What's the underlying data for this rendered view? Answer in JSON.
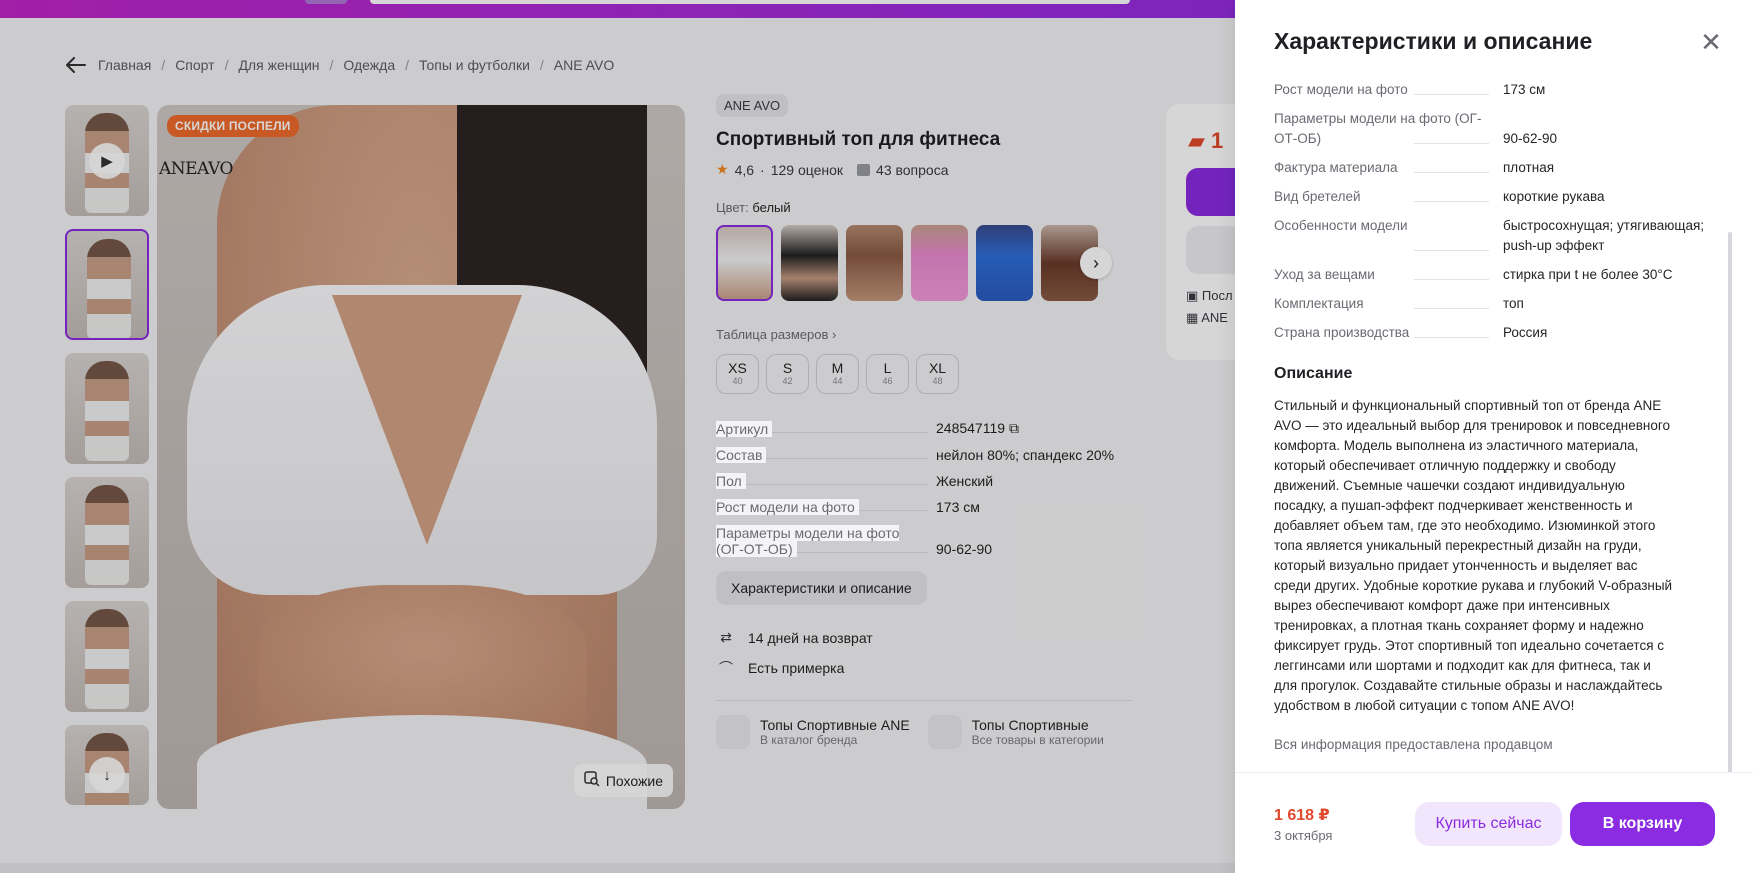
{
  "breadcrumb": [
    "Главная",
    "Спорт",
    "Для женщин",
    "Одежда",
    "Топы и футболки",
    "ANE AVO"
  ],
  "gallery": {
    "sale_badge": "СКИДКИ ПОСПЕЛИ",
    "brand_mark": "ANEAVO",
    "similar_label": "Похожие"
  },
  "product": {
    "brand": "ANE AVO",
    "title": "Спортивный топ для фитнеса",
    "rating": "4,6",
    "reviews": "129 оценок",
    "questions": "43 вопроса",
    "color_label": "Цвет:",
    "color_value": "белый",
    "size_table_label": "Таблица размеров",
    "sizes": [
      {
        "name": "XS",
        "ru": "40"
      },
      {
        "name": "S",
        "ru": "42"
      },
      {
        "name": "M",
        "ru": "44"
      },
      {
        "name": "L",
        "ru": "46"
      },
      {
        "name": "XL",
        "ru": "48"
      }
    ],
    "specs": [
      {
        "k": "Артикул",
        "v": "248547119"
      },
      {
        "k": "Состав",
        "v": "нейлон 80%; спандекс 20%"
      },
      {
        "k": "Пол",
        "v": "Женский"
      },
      {
        "k": "Рост модели на фото",
        "v": "173 см"
      },
      {
        "k": "Параметры модели на фото (ОГ-ОТ-ОБ)",
        "v": "90-62-90"
      }
    ],
    "chars_button": "Характеристики и описание",
    "perks": [
      "14 дней на возврат",
      "Есть примерка"
    ],
    "categories": [
      {
        "title": "Топы Спортивные ANE",
        "sub": "В каталог бренда"
      },
      {
        "title": "Топы Спортивные",
        "sub": "Все товары в категории"
      }
    ]
  },
  "buybox": {
    "price_fragment": "1",
    "row1": "Посл",
    "row2": "ANE"
  },
  "drawer": {
    "title": "Характеристики и описание",
    "specs": [
      {
        "k": "Рост модели на фото",
        "v": "173 см"
      },
      {
        "k": "Параметры модели на фото (ОГ-ОТ-ОБ)",
        "v": "90-62-90"
      },
      {
        "k": "Фактура материала",
        "v": "плотная"
      },
      {
        "k": "Вид бретелей",
        "v": "короткие рукава"
      },
      {
        "k": "Особенности модели",
        "v": "быстросохнущая; утягивающая; push-up эффект"
      },
      {
        "k": "Уход за вещами",
        "v": "стирка при t не более 30°C"
      },
      {
        "k": "Комплектация",
        "v": "топ"
      },
      {
        "k": "Страна производства",
        "v": "Россия"
      }
    ],
    "description_title": "Описание",
    "description": "Стильный и функциональный спортивный топ от бренда ANE AVO — это идеальный выбор для тренировок и повседневного комфорта. Модель выполнена из эластичного материала, который обеспечивает отличную поддержку и свободу движений. Съемные чашечки создают индивидуальную посадку, а пушап-эффект подчеркивает женственность и добавляет объем там, где это необходимо. Изюминкой этого топа является уникальный перекрестный дизайн на груди, который визуально придает утонченность и выделяет вас среди других. Удобные короткие рукава и глубокий V-образный вырез обеспечивают комфорт даже при интенсивных тренировках, а плотная ткань сохраняет форму и надежно фиксирует грудь. Этот спортивный топ идеально сочетается с леггинсами или шортами и подходит как для фитнеса, так и для прогулок. Создавайте стильные образы и наслаждайтесь удобством в любой ситуации с топом ANE AVO!",
    "note": "Вся информация предоставлена продавцом",
    "footer": {
      "price": "1 618 ₽",
      "date": "3 октября",
      "buy_now": "Купить сейчас",
      "to_cart": "В корзину"
    }
  },
  "colors": {
    "accent": "#8b2be2",
    "price": "#e2482c",
    "sale_badge": "#f06a2c"
  }
}
